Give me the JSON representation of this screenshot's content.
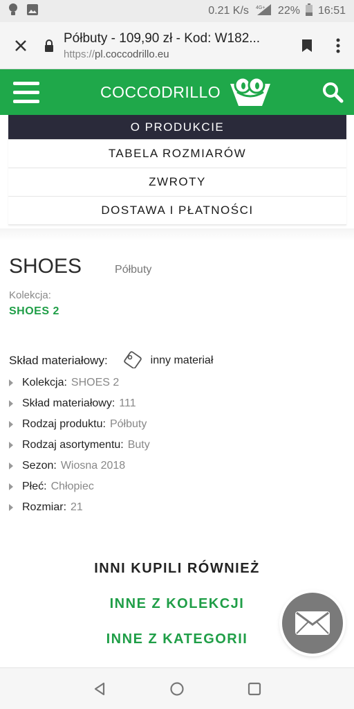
{
  "status_bar": {
    "speed": "0.21 K/s",
    "network": "4G+",
    "battery": "22%",
    "time": "16:51"
  },
  "browser": {
    "title": "Półbuty - 109,90 zł - Kod: W182...",
    "url_scheme": "https://",
    "url_host": "pl.coccodrillo.eu"
  },
  "site": {
    "logo_text": "COCCODRILLO",
    "brand_color": "#1fa84a"
  },
  "tabs": [
    {
      "label": "O PRODUKCIE",
      "active": true
    },
    {
      "label": "TABELA ROZMIARÓW",
      "active": false
    },
    {
      "label": "ZWROTY",
      "active": false
    },
    {
      "label": "DOSTAWA I PŁATNOŚCI",
      "active": false
    }
  ],
  "product": {
    "brand": "SHOES",
    "type": "Półbuty",
    "collection_label": "Kolekcja:",
    "collection_value": "SHOES 2",
    "material_label": "Skład materiałowy:",
    "material_value": "inny materiał",
    "attributes": [
      {
        "key": "Kolekcja:",
        "value": "SHOES 2"
      },
      {
        "key": "Skład materiałowy:",
        "value": "111"
      },
      {
        "key": "Rodzaj produktu:",
        "value": "Półbuty"
      },
      {
        "key": "Rodzaj asortymentu:",
        "value": "Buty"
      },
      {
        "key": "Sezon:",
        "value": "Wiosna 2018"
      },
      {
        "key": "Płeć:",
        "value": "Chłopiec"
      },
      {
        "key": "Rozmiar:",
        "value": "21"
      }
    ]
  },
  "links": {
    "also_bought": "INNI KUPILI RÓWNIEŻ",
    "from_collection": "INNE Z KOLEKCJI",
    "from_category": "INNE Z KATEGORII"
  },
  "icons": {
    "status_left": [
      "bulb-icon",
      "image-icon"
    ],
    "header": [
      "hamburger-icon",
      "crocodile-logo-icon",
      "search-icon"
    ],
    "fab": "mail-icon",
    "nav": [
      "back-icon",
      "home-icon",
      "recents-icon"
    ]
  }
}
